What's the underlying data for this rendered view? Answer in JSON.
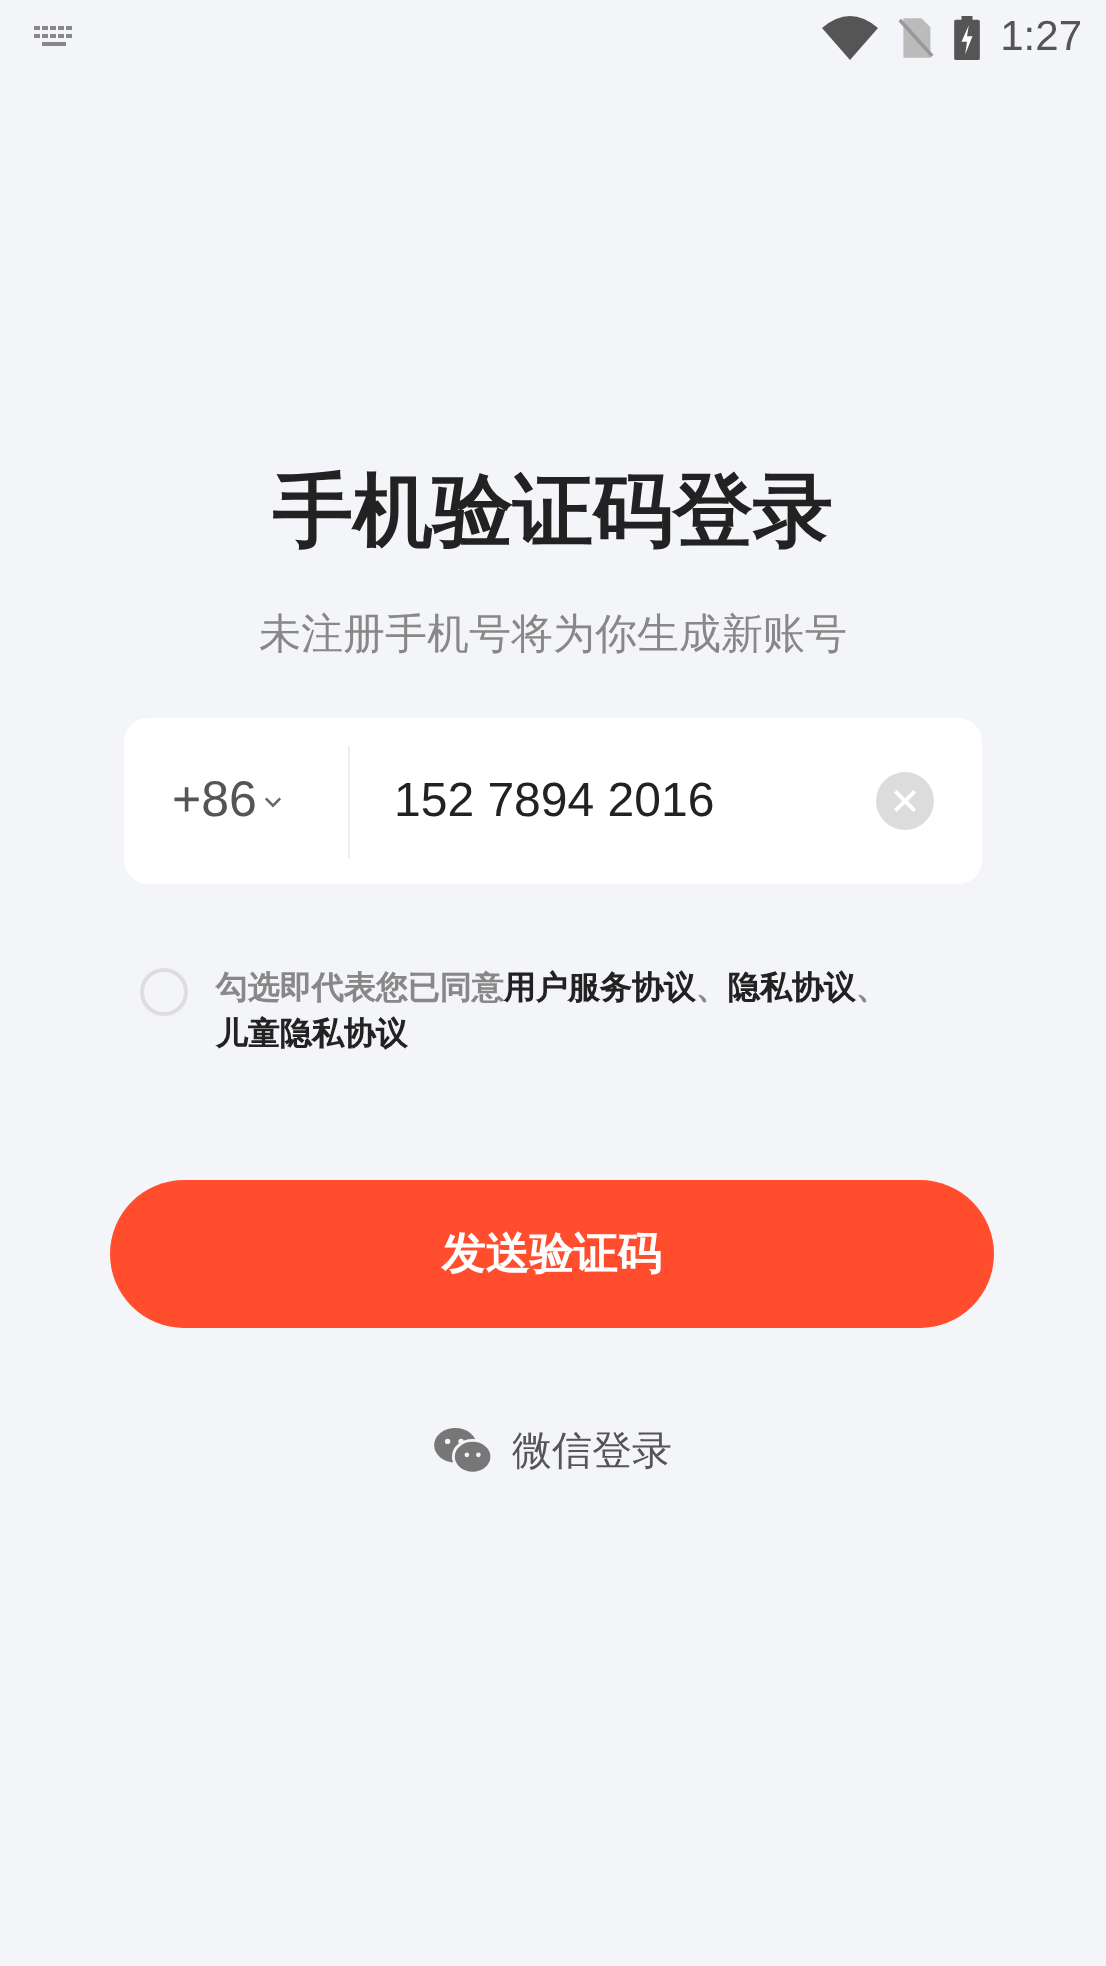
{
  "status_bar": {
    "time": "1:27"
  },
  "title": "手机验证码登录",
  "subtitle": "未注册手机号将为你生成新账号",
  "phone": {
    "country_code": "+86",
    "value": "152 7894 2016"
  },
  "agreement": {
    "checked": false,
    "prefix": "勾选即代表您已同意",
    "separator": "、",
    "links": [
      "用户服务协议",
      "隐私协议",
      "儿童隐私协议"
    ]
  },
  "submit_button": "发送验证码",
  "wechat_login": "微信登录"
}
